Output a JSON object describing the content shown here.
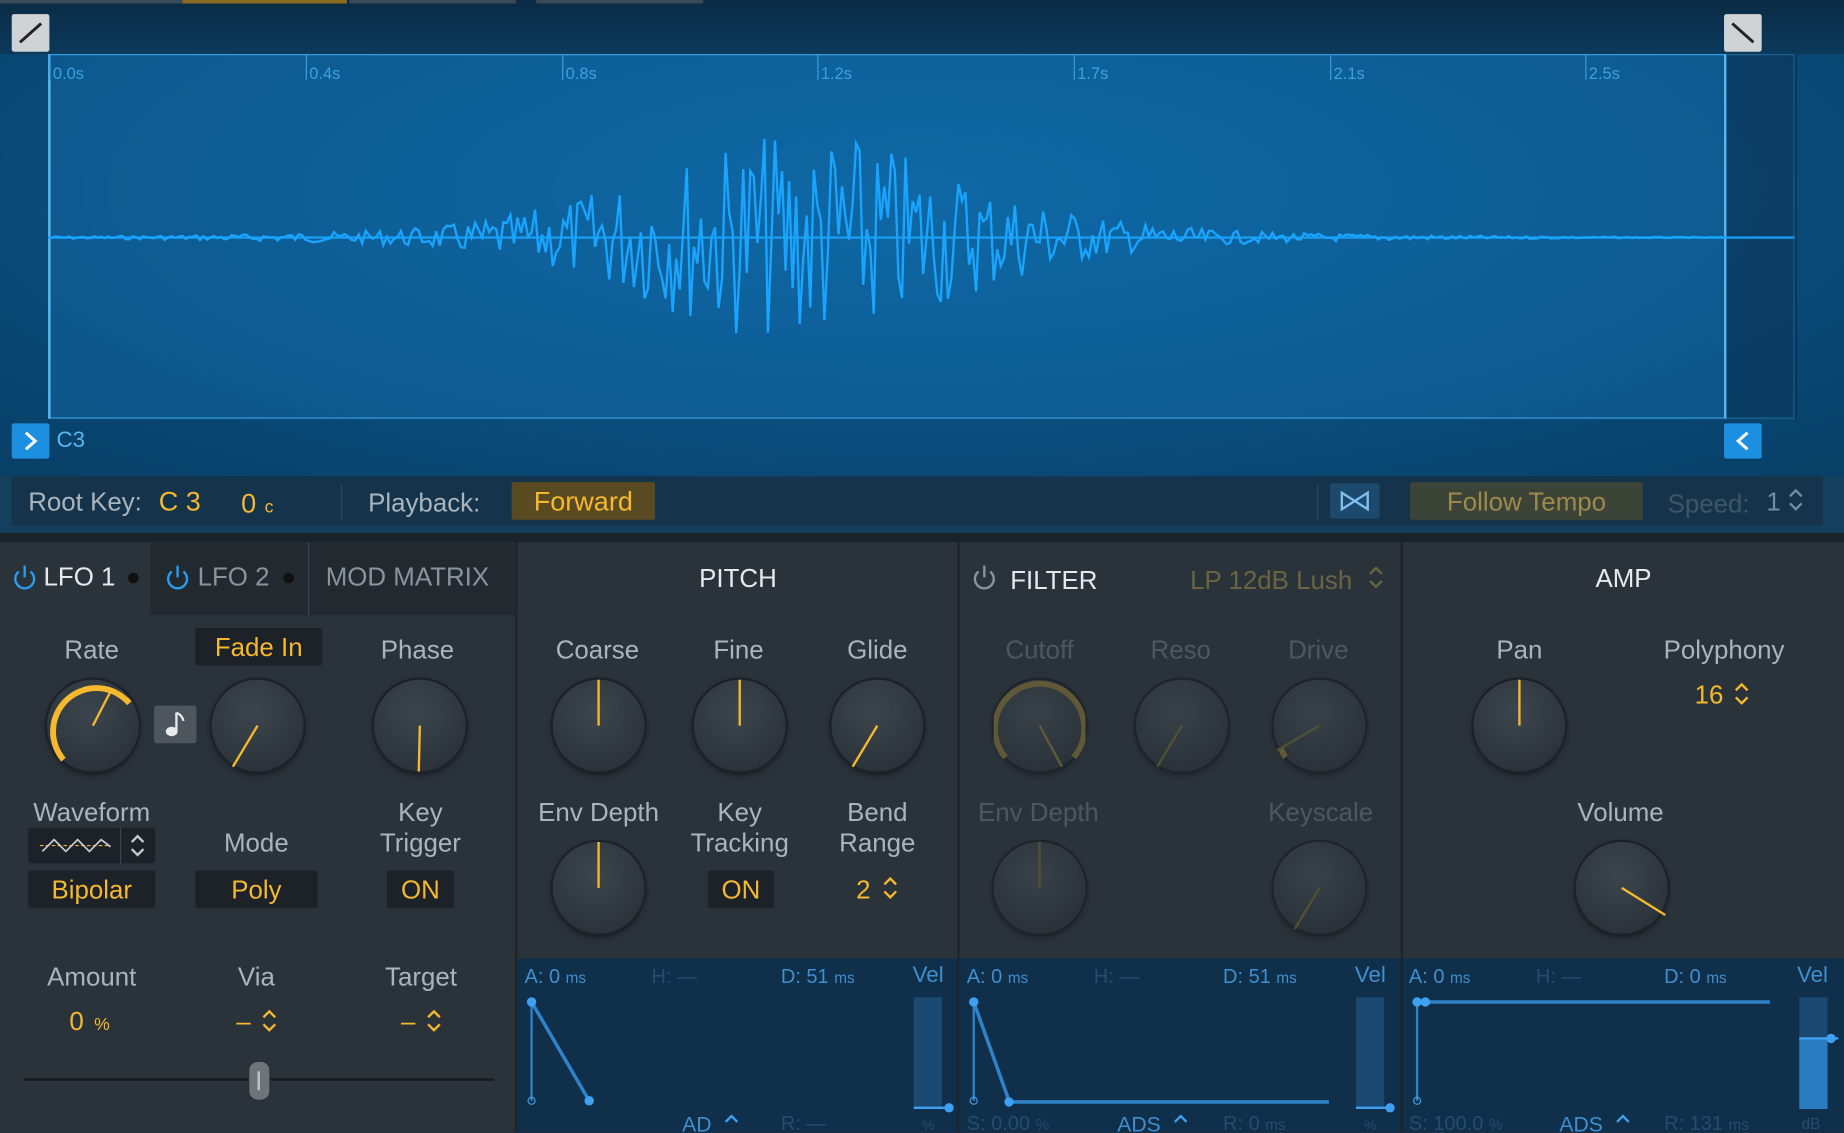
{
  "waveform": {
    "time_ticks": [
      "0.0s",
      "0.4s",
      "0.8s",
      "1.2s",
      "1.7s",
      "2.1s",
      "2.5s"
    ],
    "root_note_label": "C3"
  },
  "playback_bar": {
    "root_key_label": "Root Key:",
    "root_key_value": "C 3",
    "cents_value": "0",
    "cents_unit": "c",
    "playback_label": "Playback:",
    "playback_value": "Forward",
    "follow_tempo_label": "Follow Tempo",
    "speed_label": "Speed:",
    "speed_value": "1"
  },
  "lfo": {
    "tabs": [
      "LFO 1",
      "LFO 2",
      "MOD MATRIX"
    ],
    "rate_label": "Rate",
    "fade_in_label": "Fade In",
    "phase_label": "Phase",
    "waveform_label": "Waveform",
    "mode_label": "Mode",
    "key_trigger_label": "Key\nTrigger",
    "bipolar_value": "Bipolar",
    "mode_value": "Poly",
    "key_trigger_value": "ON",
    "amount_label": "Amount",
    "via_label": "Via",
    "target_label": "Target",
    "amount_value": "0",
    "amount_unit": "%",
    "via_value": "–",
    "target_value": "–"
  },
  "pitch": {
    "title": "PITCH",
    "coarse_label": "Coarse",
    "fine_label": "Fine",
    "glide_label": "Glide",
    "env_depth_label": "Env Depth",
    "key_tracking_label": "Key\nTracking",
    "bend_range_label": "Bend\nRange",
    "key_tracking_value": "ON",
    "bend_range_value": "2",
    "env": {
      "a": "A: 0",
      "a_unit": "ms",
      "h": "H: —",
      "d": "D: 51",
      "d_unit": "ms",
      "vel": "Vel",
      "mode": "AD",
      "r": "R: —",
      "pct": "%"
    }
  },
  "filter": {
    "title": "FILTER",
    "type_value": "LP 12dB Lush",
    "cutoff_label": "Cutoff",
    "reso_label": "Reso",
    "drive_label": "Drive",
    "env_depth_label": "Env Depth",
    "keyscale_label": "Keyscale",
    "env": {
      "a": "A: 0",
      "a_unit": "ms",
      "h": "H: —",
      "d": "D: 51",
      "d_unit": "ms",
      "vel": "Vel",
      "s": "S: 0.00",
      "s_unit": "%",
      "mode": "ADS",
      "r": "R: 0",
      "r_unit": "ms",
      "pct": "%"
    }
  },
  "amp": {
    "title": "AMP",
    "pan_label": "Pan",
    "polyphony_label": "Polyphony",
    "polyphony_value": "16",
    "volume_label": "Volume",
    "env": {
      "a": "A: 0",
      "a_unit": "ms",
      "h": "H: —",
      "d": "D: 0",
      "d_unit": "ms",
      "vel": "Vel",
      "s": "S: 100.0",
      "s_unit": "%",
      "mode": "ADS",
      "r": "R: 131",
      "r_unit": "ms",
      "db": "dB"
    }
  },
  "colors": {
    "accent": "#f5b82e",
    "wave": "#14a0ff",
    "blue_text": "#3fa0e0",
    "panel_bg": "#2b333a"
  }
}
